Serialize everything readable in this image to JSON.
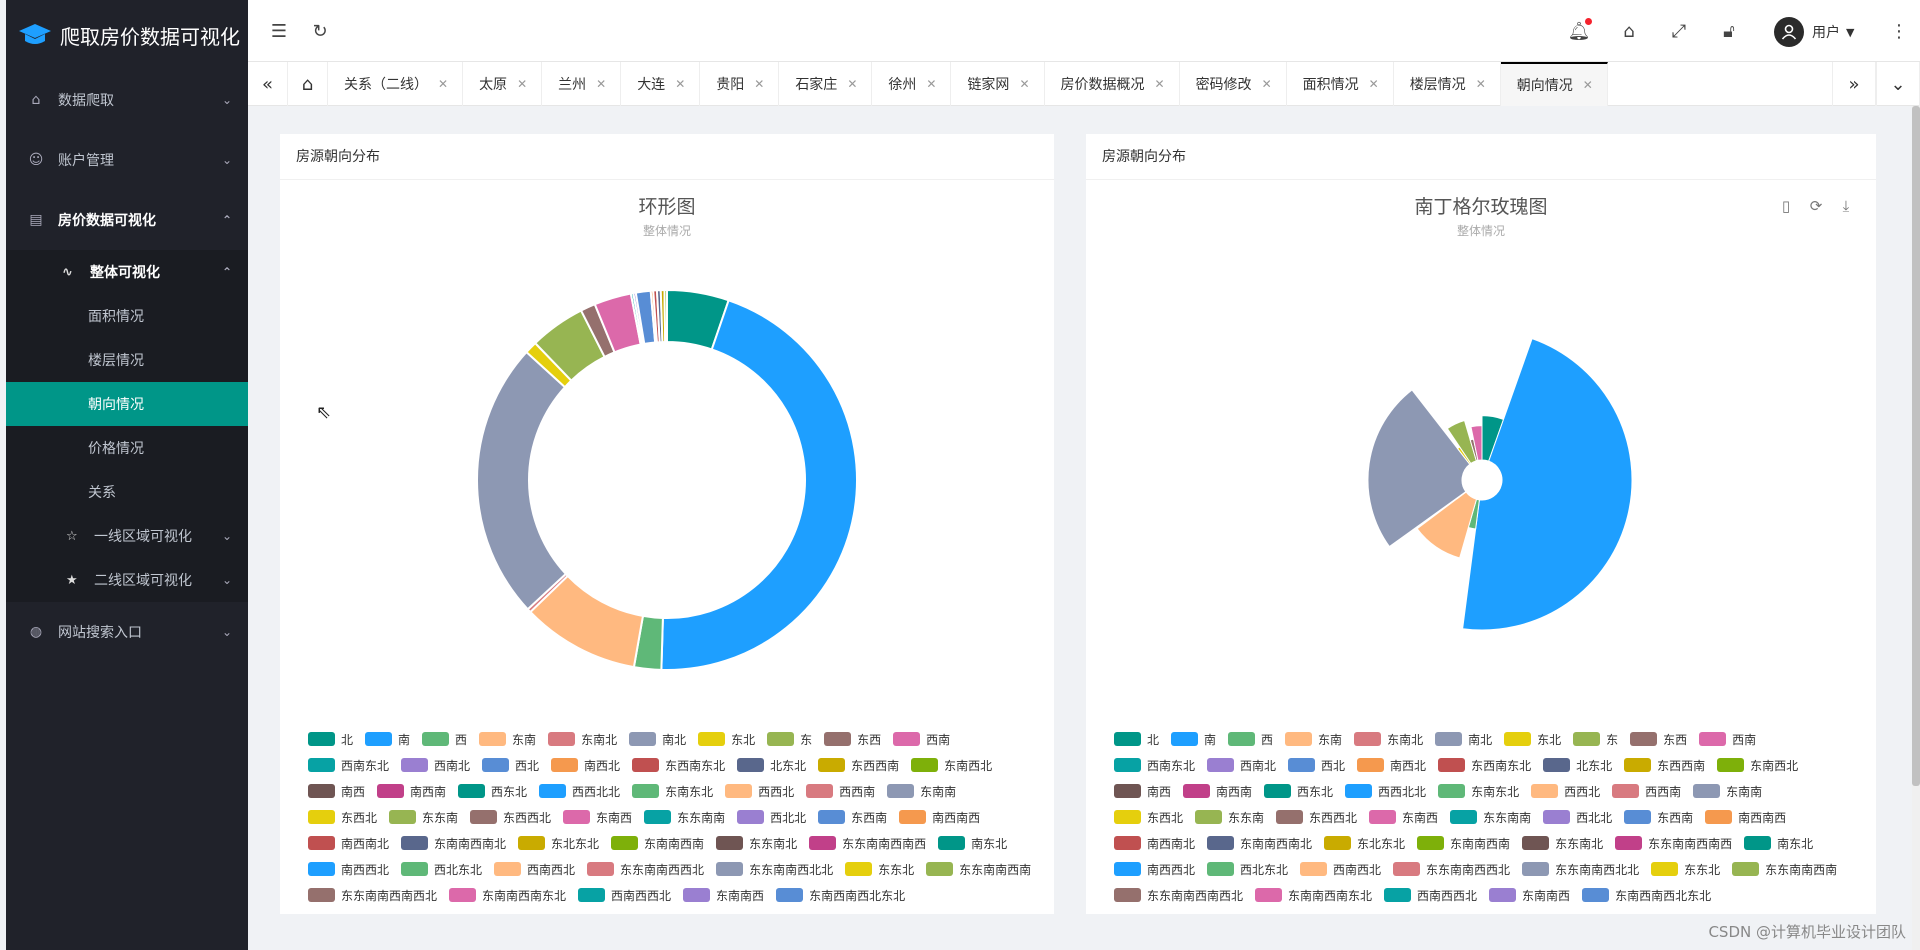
{
  "app": {
    "title": "爬取房价数据可视化"
  },
  "sidebar": {
    "items": [
      {
        "label": "数据爬取",
        "icon": "home-icon",
        "expanded": false
      },
      {
        "label": "账户管理",
        "icon": "smile-icon",
        "expanded": false
      },
      {
        "label": "房价数据可视化",
        "icon": "table-icon",
        "expanded": true,
        "children": [
          {
            "label": "整体可视化",
            "icon": "pulse-icon",
            "expanded": true,
            "children": [
              {
                "label": "面积情况"
              },
              {
                "label": "楼层情况"
              },
              {
                "label": "朝向情况",
                "active": true
              },
              {
                "label": "价格情况"
              },
              {
                "label": "关系"
              }
            ]
          },
          {
            "label": "一线区域可视化",
            "icon": "star-outline-icon",
            "expanded": false
          },
          {
            "label": "二线区域可视化",
            "icon": "star-filled-icon",
            "expanded": false
          }
        ]
      },
      {
        "label": "网站搜索入口",
        "icon": "globe-icon",
        "expanded": false
      }
    ]
  },
  "header": {
    "user_label": "用户"
  },
  "tabs": [
    {
      "label": "关系（二线）"
    },
    {
      "label": "太原"
    },
    {
      "label": "兰州"
    },
    {
      "label": "大连"
    },
    {
      "label": "贵阳"
    },
    {
      "label": "石家庄"
    },
    {
      "label": "徐州"
    },
    {
      "label": "链家网"
    },
    {
      "label": "房价数据概况"
    },
    {
      "label": "密码修改"
    },
    {
      "label": "面积情况"
    },
    {
      "label": "楼层情况"
    },
    {
      "label": "朝向情况",
      "active": true
    }
  ],
  "cards": [
    {
      "header": "房源朝向分布",
      "title": "环形图",
      "subtitle": "整体情况"
    },
    {
      "header": "房源朝向分布",
      "title": "南丁格尔玫瑰图",
      "subtitle": "整体情况"
    }
  ],
  "watermark": "CSDN @计算机毕业设计团队",
  "chart_data": [
    {
      "type": "pie",
      "variant": "donut",
      "title": "环形图",
      "subtitle": "整体情况",
      "categories": [
        "北",
        "南",
        "西",
        "东南",
        "东南北",
        "南北",
        "东北",
        "东",
        "东西",
        "西南",
        "西南东北",
        "西南北",
        "西北",
        "南西北",
        "东西南东北",
        "北东北",
        "东西西南",
        "东南西北"
      ],
      "values": [
        5,
        43,
        2.2,
        9.5,
        0.3,
        22.5,
        1,
        4.5,
        1.2,
        3,
        0.2,
        0.2,
        1.2,
        0.2,
        0.3,
        0.3,
        0.3,
        0.2
      ],
      "legend_position": "bottom"
    },
    {
      "type": "pie",
      "variant": "nightingale-rose",
      "title": "南丁格尔玫瑰图",
      "subtitle": "整体情况",
      "categories": [
        "北",
        "南",
        "西",
        "东南",
        "东南北",
        "南北",
        "东北",
        "东",
        "东西",
        "西南"
      ],
      "values": [
        5,
        43,
        2.2,
        9.5,
        0.3,
        22.5,
        1,
        4.5,
        1.2,
        3
      ],
      "legend_position": "bottom"
    }
  ],
  "legend": [
    {
      "label": "北",
      "color": "#009688"
    },
    {
      "label": "南",
      "color": "#1e9fff"
    },
    {
      "label": "西",
      "color": "#5fb878"
    },
    {
      "label": "东南",
      "color": "#ffb980"
    },
    {
      "label": "东南北",
      "color": "#d87a80"
    },
    {
      "label": "南北",
      "color": "#8d98b3"
    },
    {
      "label": "东北",
      "color": "#e5cf0d"
    },
    {
      "label": "东",
      "color": "#97b552"
    },
    {
      "label": "东西",
      "color": "#95706d"
    },
    {
      "label": "西南",
      "color": "#dc69aa"
    },
    {
      "label": "西南东北",
      "color": "#07a2a4"
    },
    {
      "label": "西南北",
      "color": "#9a7fd1"
    },
    {
      "label": "西北",
      "color": "#588dd5"
    },
    {
      "label": "南西北",
      "color": "#f5994e"
    },
    {
      "label": "东西南东北",
      "color": "#c05050"
    },
    {
      "label": "北东北",
      "color": "#59678c"
    },
    {
      "label": "东西西南",
      "color": "#c9ab00"
    },
    {
      "label": "东南西北",
      "color": "#7eb00a"
    },
    {
      "label": "南西",
      "color": "#6f5553"
    },
    {
      "label": "南西南",
      "color": "#c14089"
    },
    {
      "label": "西东北",
      "color": "#009688"
    },
    {
      "label": "西西北北",
      "color": "#1e9fff"
    },
    {
      "label": "东南东北",
      "color": "#5fb878"
    },
    {
      "label": "西西北",
      "color": "#ffb980"
    },
    {
      "label": "西西南",
      "color": "#d87a80"
    },
    {
      "label": "东南南",
      "color": "#8d98b3"
    },
    {
      "label": "东西北",
      "color": "#e5cf0d"
    },
    {
      "label": "东东南",
      "color": "#97b552"
    },
    {
      "label": "东西西北",
      "color": "#95706d"
    },
    {
      "label": "东南西",
      "color": "#dc69aa"
    },
    {
      "label": "东东南南",
      "color": "#07a2a4"
    },
    {
      "label": "西北北",
      "color": "#9a7fd1"
    },
    {
      "label": "东西南",
      "color": "#588dd5"
    },
    {
      "label": "南西南西",
      "color": "#f5994e"
    },
    {
      "label": "南西南北",
      "color": "#c05050"
    },
    {
      "label": "东南南西南北",
      "color": "#59678c"
    },
    {
      "label": "东北东北",
      "color": "#c9ab00"
    },
    {
      "label": "东南南西南",
      "color": "#7eb00a"
    },
    {
      "label": "东东南北",
      "color": "#6f5553"
    },
    {
      "label": "东东南南西南西",
      "color": "#c14089"
    },
    {
      "label": "南东北",
      "color": "#009688"
    },
    {
      "label": "南西西北",
      "color": "#1e9fff"
    },
    {
      "label": "西北东北",
      "color": "#5fb878"
    },
    {
      "label": "西南西北",
      "color": "#ffb980"
    },
    {
      "label": "东东南南西西北",
      "color": "#d87a80"
    },
    {
      "label": "东东南南西北北",
      "color": "#8d98b3"
    },
    {
      "label": "东东北",
      "color": "#e5cf0d"
    },
    {
      "label": "东东南南西南",
      "color": "#97b552"
    },
    {
      "label": "东东南南西南西北",
      "color": "#95706d"
    },
    {
      "label": "东南南西南东北",
      "color": "#dc69aa"
    },
    {
      "label": "西南西西北",
      "color": "#07a2a4"
    },
    {
      "label": "东南南西",
      "color": "#9a7fd1"
    },
    {
      "label": "东南西南西北东北",
      "color": "#588dd5"
    }
  ]
}
